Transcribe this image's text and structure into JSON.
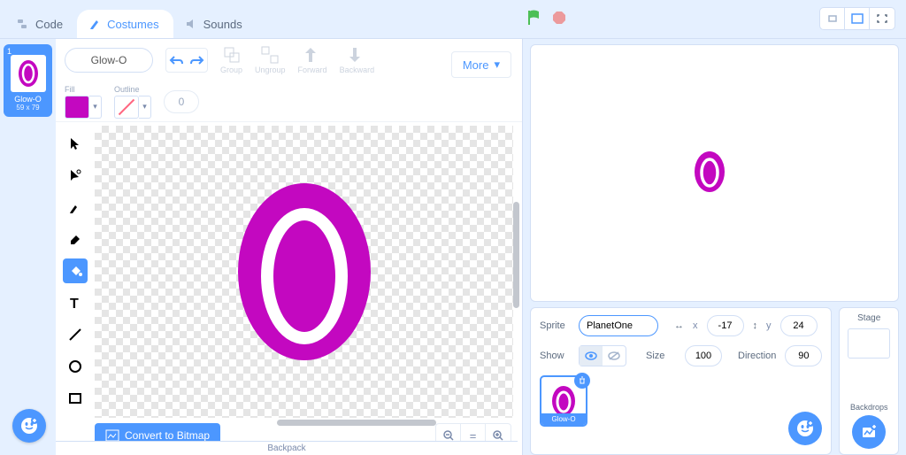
{
  "tabs": {
    "code": "Code",
    "costumes": "Costumes",
    "sounds": "Sounds"
  },
  "costume": {
    "number": "1",
    "name": "Glow-O",
    "dims": "59 x 79"
  },
  "editor": {
    "fill_label": "Fill",
    "outline_label": "Outline",
    "outline_width": "0",
    "group": "Group",
    "ungroup": "Ungroup",
    "forward": "Forward",
    "backward": "Backward",
    "more": "More",
    "convert": "Convert to Bitmap",
    "fill_color": "#c308c0"
  },
  "sprite": {
    "label": "Sprite",
    "name": "PlanetOne",
    "x_label": "x",
    "x": "-17",
    "y_label": "y",
    "y": "24",
    "show": "Show",
    "size_label": "Size",
    "size": "100",
    "dir_label": "Direction",
    "dir": "90",
    "card_name": "Glow-O"
  },
  "stage": {
    "title": "Stage",
    "backdrops": "Backdrops"
  },
  "backpack": "Backpack"
}
